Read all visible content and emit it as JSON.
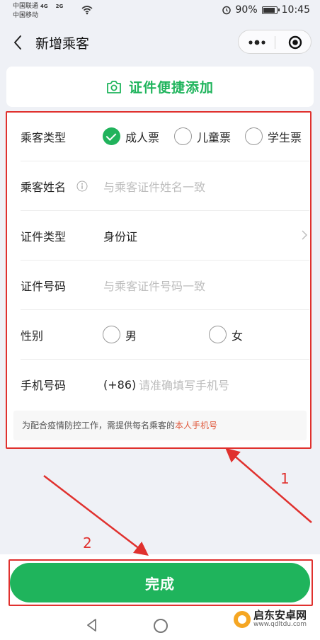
{
  "status_bar": {
    "carrier_1": "中国联通",
    "net_1": "4G",
    "net_2": "2G",
    "carrier_2": "中国移动",
    "battery": "90%",
    "battery_level": 0.9,
    "time": "10:45"
  },
  "nav": {
    "title": "新增乘客"
  },
  "quick_add": {
    "label": "证件便捷添加"
  },
  "form": {
    "passenger_type": {
      "label": "乘客类型",
      "options": [
        "成人票",
        "儿童票",
        "学生票"
      ],
      "selected": "成人票"
    },
    "name": {
      "label": "乘客姓名",
      "placeholder": "与乘客证件姓名一致"
    },
    "id_type": {
      "label": "证件类型",
      "value": "身份证"
    },
    "id_number": {
      "label": "证件号码",
      "placeholder": "与乘客证件号码一致"
    },
    "gender": {
      "label": "性别",
      "options": [
        "男",
        "女"
      ]
    },
    "phone": {
      "label": "手机号码",
      "prefix": "(+86)",
      "placeholder": "请准确填写手机号"
    },
    "notice": {
      "text": "为配合疫情防控工作，需提供每名乘客的",
      "highlight": "本人手机号"
    }
  },
  "annotations": {
    "label_1": "1",
    "label_2": "2"
  },
  "bottom": {
    "done_label": "完成"
  },
  "watermark": {
    "name": "启东安卓网",
    "url": "www.qdltdu.com"
  },
  "colors": {
    "accent": "#1fb45c",
    "annotation": "#e0312e",
    "notice_highlight": "#e05a3d"
  }
}
